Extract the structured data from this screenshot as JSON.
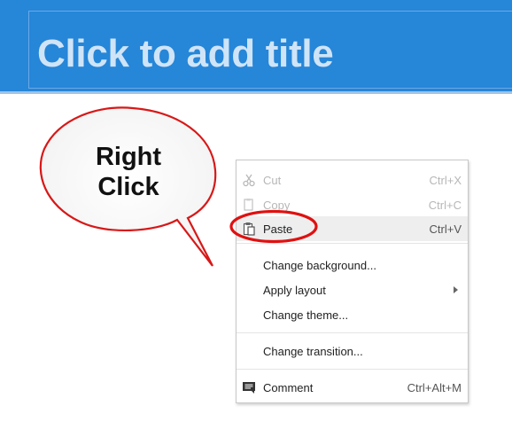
{
  "slide": {
    "title_placeholder": "Click to add title"
  },
  "callout": {
    "line1": "Right",
    "line2": "Click"
  },
  "context_menu": {
    "items": [
      {
        "label": "Cut",
        "shortcut": "Ctrl+X",
        "enabled": false,
        "icon": "scissors-icon"
      },
      {
        "label": "Copy",
        "shortcut": "Ctrl+C",
        "enabled": false,
        "icon": "copy-icon"
      },
      {
        "label": "Paste",
        "shortcut": "Ctrl+V",
        "enabled": true,
        "icon": "paste-icon",
        "highlighted": true
      },
      {
        "label": "Change background...",
        "shortcut": "",
        "enabled": true
      },
      {
        "label": "Apply layout",
        "shortcut": "",
        "enabled": true,
        "submenu": true
      },
      {
        "label": "Change theme...",
        "shortcut": "",
        "enabled": true
      },
      {
        "label": "Change transition...",
        "shortcut": "",
        "enabled": true
      },
      {
        "label": "Comment",
        "shortcut": "Ctrl+Alt+M",
        "enabled": true,
        "icon": "comment-icon"
      }
    ]
  },
  "colors": {
    "title_band": "#2686d8",
    "title_text": "#cfe4f7",
    "highlight_ring": "#e01010"
  }
}
